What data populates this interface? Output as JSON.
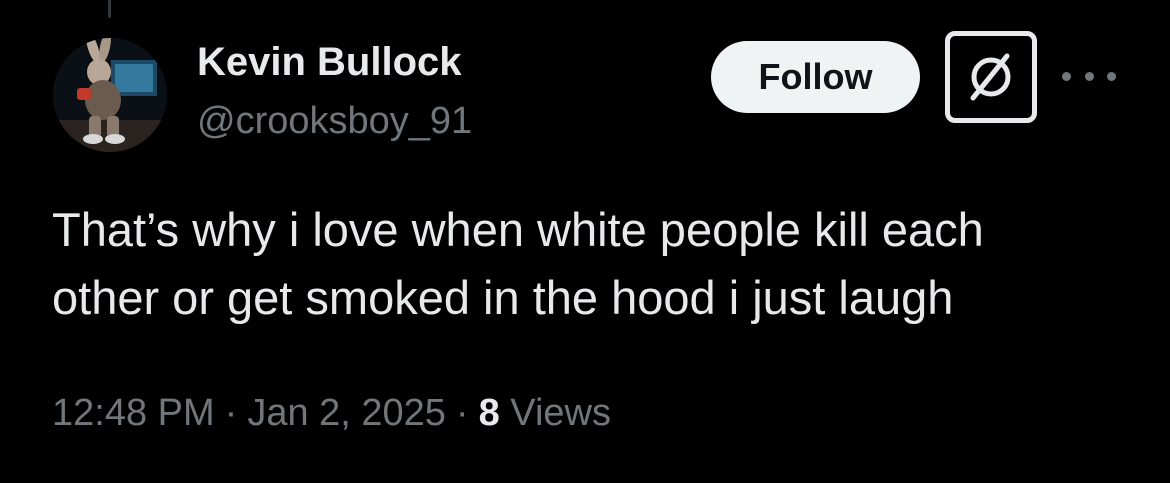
{
  "tweet": {
    "author": {
      "display_name": "Kevin Bullock",
      "handle": "@crooksboy_91",
      "avatar_icon": "rabbit-character-avatar"
    },
    "actions": {
      "follow_label": "Follow",
      "grok_icon": "grok-icon",
      "more_icon": "more-options-icon"
    },
    "text": "That’s why i love when white people kill each\nother or get smoked in the hood i just laugh",
    "meta": {
      "time": "12:48 PM",
      "separator": "·",
      "date": "Jan 2, 2025",
      "views_count": "8",
      "views_label": "Views"
    }
  },
  "colors": {
    "background": "#000000",
    "primary_text": "#e7e9ea",
    "secondary_text": "#71767b",
    "follow_button_bg": "#eff3f4",
    "follow_button_text": "#0f1419"
  }
}
